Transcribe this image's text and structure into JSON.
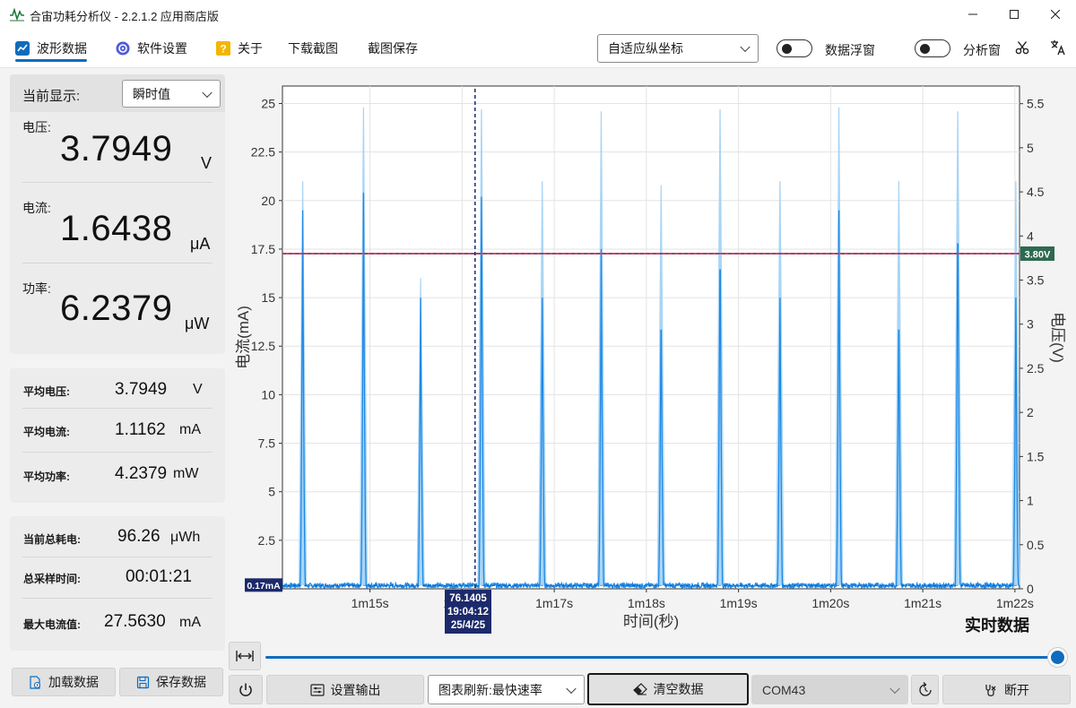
{
  "window": {
    "title": "合宙功耗分析仪 - 2.2.1.2 应用商店版"
  },
  "toolbar": {
    "tabs": [
      {
        "label": "波形数据",
        "icon": "chart-wave-icon"
      },
      {
        "label": "软件设置",
        "icon": "gear-icon"
      },
      {
        "label": "关于",
        "icon": "question-icon"
      },
      {
        "label": "下载截图"
      },
      {
        "label": "截图保存"
      }
    ],
    "axis_mode": "自适应纵坐标",
    "data_float_label": "数据浮窗",
    "analysis_label": "分析窗"
  },
  "display": {
    "label": "当前显示:",
    "mode": "瞬时值",
    "voltage_label": "电压:",
    "voltage_value": "3.7949",
    "voltage_unit": "V",
    "current_label": "电流:",
    "current_value": "1.6438",
    "current_unit": "μA",
    "power_label": "功率:",
    "power_value": "6.2379",
    "power_unit": "μW"
  },
  "averages": {
    "avg_voltage_label": "平均电压:",
    "avg_voltage_value": "3.7949",
    "avg_voltage_unit": "V",
    "avg_current_label": "平均电流:",
    "avg_current_value": "1.1162",
    "avg_current_unit": "mA",
    "avg_power_label": "平均功率:",
    "avg_power_value": "4.2379",
    "avg_power_unit": "mW"
  },
  "totals": {
    "energy_label": "当前总耗电:",
    "energy_value": "96.26",
    "energy_unit": "μWh",
    "time_label": "总采样时间:",
    "time_value": "00:01:21",
    "max_label": "最大电流值:",
    "max_value": "27.5630",
    "max_unit": "mA"
  },
  "buttons": {
    "load": "加载数据",
    "save": "保存数据",
    "output": "设置输出",
    "refresh": "图表刷新:最快速率",
    "clear": "清空数据",
    "port": "COM43",
    "disconnect": "断开"
  },
  "colors": {
    "accent": "#0f6cbd",
    "current_line": "#1e88e5",
    "current_band": "#9fd0f5",
    "voltage_line": "#e0407a",
    "label_bg": "#1c2a6b",
    "voltage_tag_bg": "#2e6a52"
  },
  "chart_data": {
    "type": "line",
    "xlabel": "时间(秒)",
    "ylabel": "电流(mA)",
    "y2label": "电压(V)",
    "mode_label": "实时数据",
    "xlim": [
      74.05,
      82.05
    ],
    "ylim": [
      0,
      25.9
    ],
    "y2lim": [
      0,
      5.7
    ],
    "x_ticks": [
      "1m15s",
      "1m16s",
      "1m17s",
      "1m18s",
      "1m19s",
      "1m20s",
      "1m21s",
      "1m22s"
    ],
    "x_tick_values": [
      75,
      76,
      77,
      78,
      79,
      80,
      81,
      82
    ],
    "y_ticks": [
      "2.5",
      "5",
      "7.5",
      "10",
      "12.5",
      "15",
      "17.5",
      "20",
      "22.5",
      "25"
    ],
    "y_tick_values": [
      2.5,
      5,
      7.5,
      10,
      12.5,
      15,
      17.5,
      20,
      22.5,
      25
    ],
    "y2_ticks": [
      "0",
      "0.5",
      "1",
      "1.5",
      "2",
      "2.5",
      "3",
      "3.5",
      "4",
      "4.5",
      "5",
      "5.5"
    ],
    "y2_tick_values": [
      0,
      0.5,
      1,
      1.5,
      2,
      2.5,
      3,
      3.5,
      4,
      4.5,
      5,
      5.5
    ],
    "grid": true,
    "baseline_current": 0.17,
    "baseline_label": "0.17mA",
    "voltage_level": 3.8,
    "voltage_label": "3.80V",
    "cursor": {
      "x": 76.1405,
      "lines": [
        "76.1405",
        "19:04:12",
        "25/4/25"
      ]
    },
    "series": [
      {
        "name": "电流",
        "unit": "mA",
        "spikes": [
          {
            "x": 74.27,
            "peak": 19.5,
            "band": 21.0
          },
          {
            "x": 74.93,
            "peak": 20.4,
            "band": 24.8
          },
          {
            "x": 75.55,
            "peak": 15.0,
            "band": 16.0
          },
          {
            "x": 76.21,
            "peak": 20.2,
            "band": 24.7
          },
          {
            "x": 76.87,
            "peak": 15.0,
            "band": 21.0
          },
          {
            "x": 77.51,
            "peak": 17.5,
            "band": 24.6
          },
          {
            "x": 78.16,
            "peak": 15.0,
            "band": 20.8
          },
          {
            "x": 78.8,
            "peak": 18.5,
            "band": 24.7
          },
          {
            "x": 79.45,
            "peak": 15.0,
            "band": 21.0
          },
          {
            "x": 80.09,
            "peak": 19.5,
            "band": 24.8
          },
          {
            "x": 80.74,
            "peak": 15.0,
            "band": 21.0
          },
          {
            "x": 81.38,
            "peak": 20.0,
            "band": 24.6
          },
          {
            "x": 82.01,
            "peak": 15.0,
            "band": 21.0
          }
        ]
      },
      {
        "name": "电压",
        "unit": "V",
        "value": 3.8
      }
    ]
  }
}
